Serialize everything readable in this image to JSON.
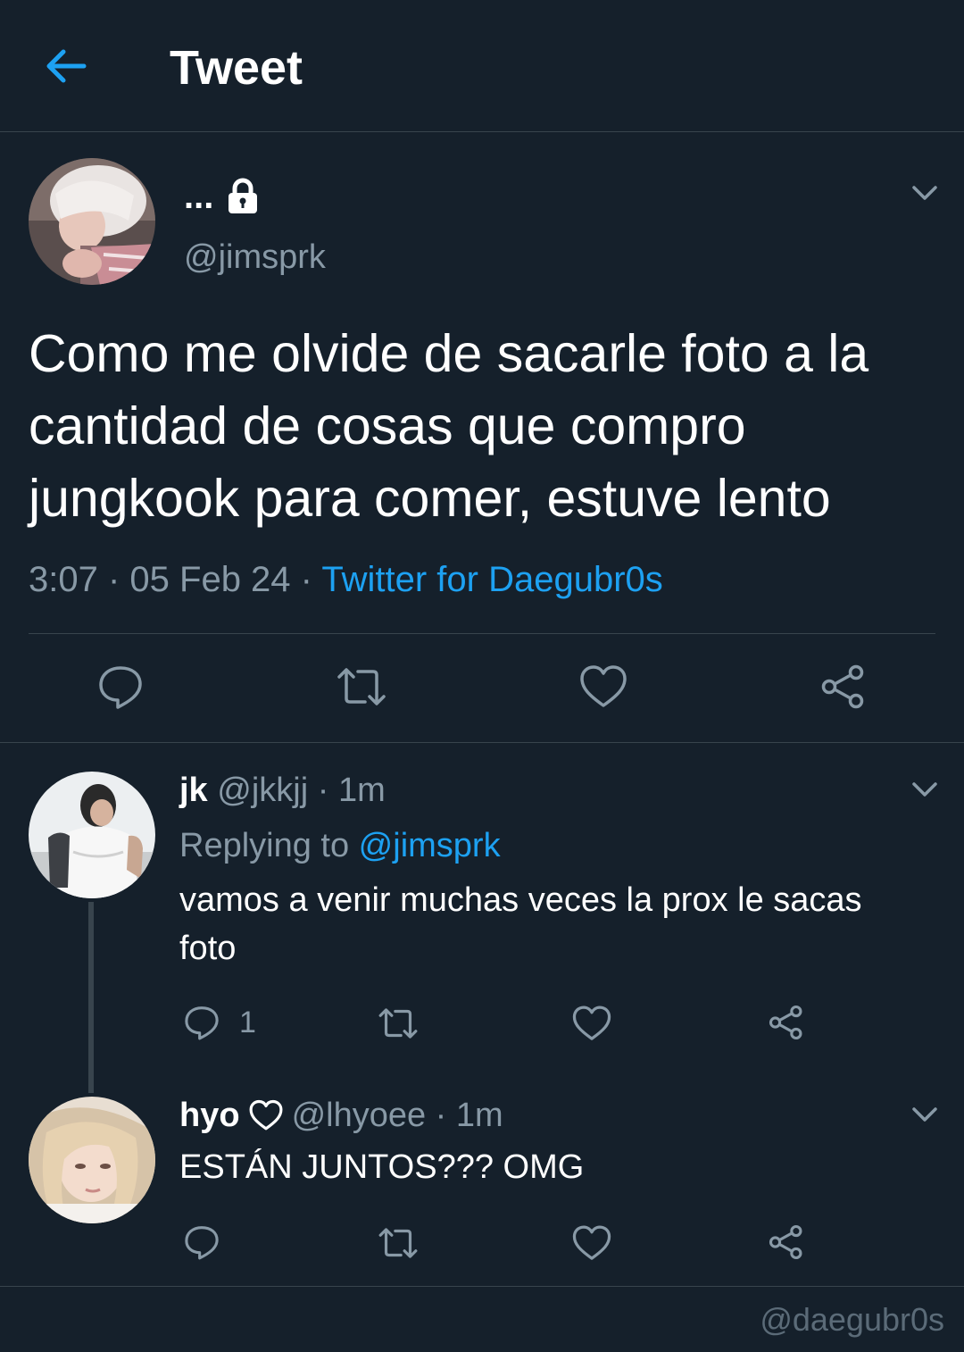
{
  "header": {
    "title": "Tweet",
    "back_icon": "arrow-left-icon",
    "accent_color": "#1da1f2"
  },
  "main_tweet": {
    "author_name": "...",
    "author_protected_icon": "lock-icon",
    "author_handle": "@jimsprk",
    "text": "Como me olvide de sacarle foto a la cantidad de cosas que compro jungkook para comer, estuve lento",
    "time": "3:07",
    "date": "05 Feb 24",
    "separator": " · ",
    "source": "Twitter for Daegubr0s",
    "actions": [
      "reply-icon",
      "retweet-icon",
      "like-icon",
      "share-icon"
    ]
  },
  "replies": [
    {
      "name": "jk",
      "handle": "@jkkjj",
      "time": "1m",
      "replying_prefix": "Replying to ",
      "replying_to": "@jimsprk",
      "text": "vamos a venir muchas veces la prox le sacas foto",
      "reply_count": "1"
    },
    {
      "name": "hyo",
      "name_icon": "heart-outline-icon",
      "handle": "@lhyoee",
      "time": "1m",
      "text": "ESTÁN JUNTOS??? OMG"
    }
  ],
  "watermark": "@daegubr0s",
  "colors": {
    "background": "#15202b",
    "border": "#38444d",
    "secondary_text": "#8899a6",
    "link": "#1da1f2"
  }
}
